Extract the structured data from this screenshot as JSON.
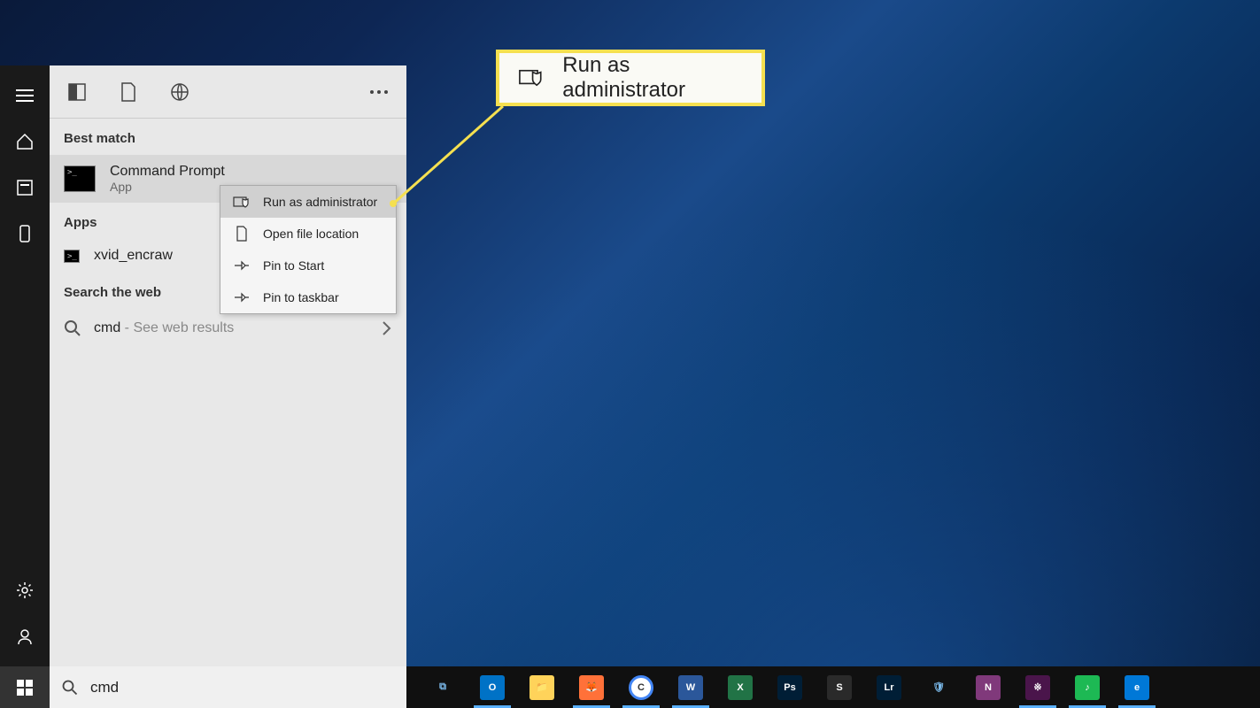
{
  "search": {
    "value": "cmd"
  },
  "panel": {
    "best_match_header": "Best match",
    "best_match": {
      "title": "Command Prompt",
      "subtitle": "App"
    },
    "apps_header": "Apps",
    "apps": [
      {
        "name": "xvid_encraw"
      }
    ],
    "web_header": "Search the web",
    "web": {
      "query": "cmd",
      "hint": " - See web results"
    }
  },
  "context_menu": {
    "items": [
      {
        "label": "Run as administrator",
        "icon": "admin-shield"
      },
      {
        "label": "Open file location",
        "icon": "folder-open"
      },
      {
        "label": "Pin to Start",
        "icon": "pin"
      },
      {
        "label": "Pin to taskbar",
        "icon": "pin"
      }
    ]
  },
  "callout": {
    "text": "Run as administrator"
  },
  "taskbar_apps": [
    {
      "name": "task-view",
      "color": "transparent",
      "label": "⧉"
    },
    {
      "name": "outlook",
      "color": "#0072c6",
      "label": "O"
    },
    {
      "name": "file-explorer",
      "color": "#ffd35a",
      "label": "📁"
    },
    {
      "name": "firefox",
      "color": "#ff7139",
      "label": "🦊"
    },
    {
      "name": "chrome",
      "color": "#ffffff",
      "label": "C"
    },
    {
      "name": "word",
      "color": "#2b579a",
      "label": "W"
    },
    {
      "name": "excel",
      "color": "#217346",
      "label": "X"
    },
    {
      "name": "photoshop",
      "color": "#001e36",
      "label": "Ps"
    },
    {
      "name": "sonos",
      "color": "#2a2a2a",
      "label": "S"
    },
    {
      "name": "lightroom",
      "color": "#001e36",
      "label": "Lr"
    },
    {
      "name": "security",
      "color": "transparent",
      "label": "🛡"
    },
    {
      "name": "onenote",
      "color": "#80397b",
      "label": "N"
    },
    {
      "name": "slack",
      "color": "#4a154b",
      "label": "※"
    },
    {
      "name": "spotify",
      "color": "#1db954",
      "label": "♪"
    },
    {
      "name": "edge",
      "color": "#0078d7",
      "label": "e"
    }
  ]
}
